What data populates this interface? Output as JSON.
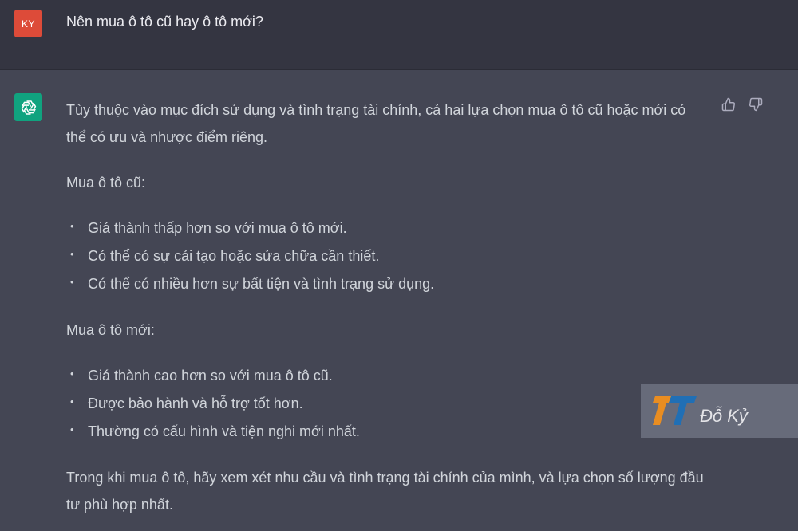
{
  "user": {
    "avatar_initials": "KY",
    "avatar_color": "#dd4b39",
    "message": "Nên mua ô tô cũ hay ô tô mới?"
  },
  "assistant": {
    "avatar_icon": "openai-logo-icon",
    "avatar_color": "#10a37f",
    "intro": "Tùy thuộc vào mục đích sử dụng và tình trạng tài chính, cả hai lựa chọn mua ô tô cũ hoặc mới có thể có ưu và nhược điểm riêng.",
    "section1_heading": "Mua ô tô cũ:",
    "section1_items": [
      "Giá thành thấp hơn so với mua ô tô mới.",
      "Có thể có sự cải tạo hoặc sửa chữa cần thiết.",
      "Có thể có nhiều hơn sự bất tiện và tình trạng sử dụng."
    ],
    "section2_heading": "Mua ô tô mới:",
    "section2_items": [
      "Giá thành cao hơn so với mua ô tô cũ.",
      "Được bảo hành và hỗ trợ tốt hơn.",
      "Thường có cấu hình và tiện nghi mới nhất."
    ],
    "conclusion": "Trong khi mua ô tô, hãy xem xét nhu cầu và tình trạng tài chính của mình, và lựa chọn số lượng đầu tư phù hợp nhất."
  },
  "feedback": {
    "thumbs_up_icon": "thumbs-up-icon",
    "thumbs_down_icon": "thumbs-down-icon"
  },
  "watermark": {
    "text": "Đỗ Kỷ",
    "logo_colors": [
      "#f7941d",
      "#1e73be"
    ]
  }
}
